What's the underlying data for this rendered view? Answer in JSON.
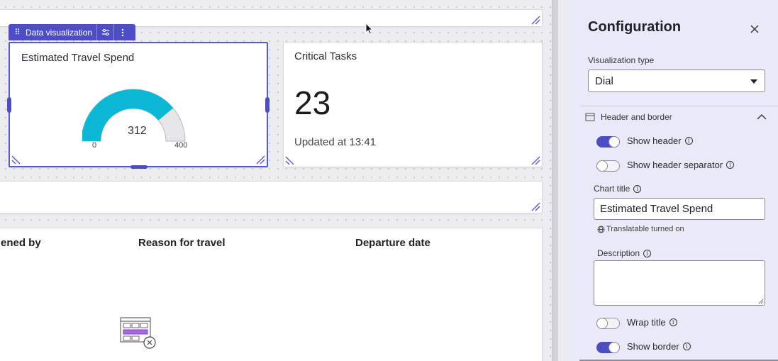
{
  "canvas": {
    "toolbar": {
      "label": "Data visualization",
      "grip_icon": "drag-grip-icon",
      "settings_icon": "sliders-icon",
      "more_icon": "more-vertical-icon"
    },
    "dial_card": {
      "title": "Estimated Travel Spend",
      "value": "312",
      "min": "0",
      "max": "400",
      "fraction": 0.78,
      "fill_color": "#0ab8d6",
      "track_color": "#e6e6ea"
    },
    "tasks_card": {
      "title": "Critical Tasks",
      "value": "23",
      "updated": "Updated at 13:41"
    },
    "table": {
      "columns": [
        "ened by",
        "Reason for travel",
        "Departure date"
      ]
    }
  },
  "config": {
    "title": "Configuration",
    "visualization_type_label": "Visualization type",
    "visualization_type_value": "Dial",
    "section_header_border": "Header and border",
    "show_header_label": "Show header",
    "show_header": true,
    "show_header_separator_label": "Show header separator",
    "show_header_separator": false,
    "chart_title_label": "Chart title",
    "chart_title_value": "Estimated Travel Spend",
    "translatable_note": "Translatable turned on",
    "description_label": "Description",
    "description_value": "",
    "wrap_title_label": "Wrap title",
    "wrap_title": false,
    "show_border_label": "Show border",
    "show_border": true,
    "accent_color": "#4d4dc2"
  }
}
